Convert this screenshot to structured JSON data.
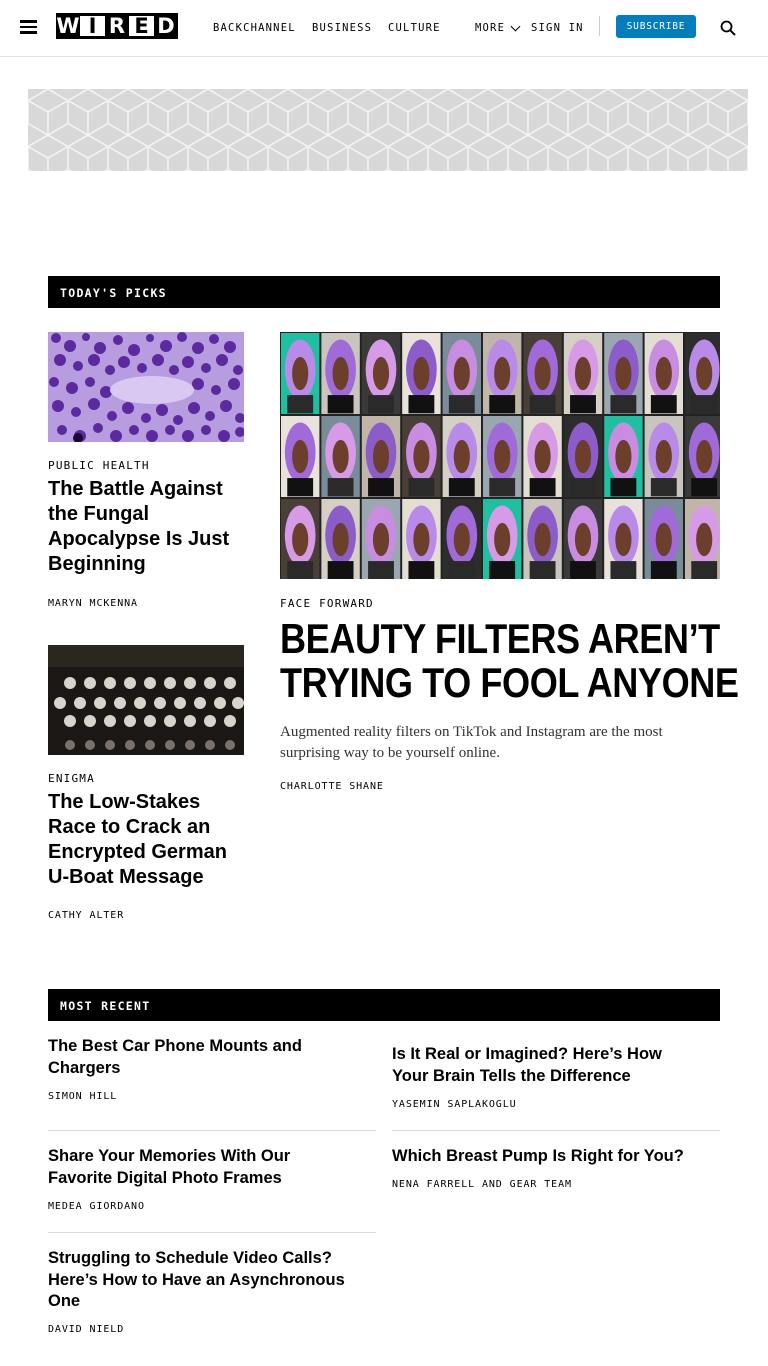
{
  "header": {
    "logo_letters": [
      "W",
      "I",
      "R",
      "E",
      "D"
    ],
    "nav_items": [
      "BACKCHANNEL",
      "BUSINESS",
      "CULTURE"
    ],
    "more_label": "MORE",
    "sign_in_label": "SIGN IN",
    "subscribe_label": "SUBSCRIBE",
    "subscribe_color": "#057dbc"
  },
  "todays_picks": {
    "title": "TODAY'S PICKS",
    "stories": [
      {
        "rubric": "PUBLIC HEALTH",
        "headline": "The Battle Against the Fungal Apocalypse Is Just Beginning",
        "byline": "MARYN MCKENNA",
        "image": "purple-cell-microscopy"
      },
      {
        "rubric": "ENIGMA",
        "headline": "The Low-Stakes Race to Crack an Encrypted German U-Boat Message",
        "byline": "CATHY ALTER",
        "image": "enigma-machine-keyboard"
      }
    ],
    "feature": {
      "rubric": "FACE FORWARD",
      "headline_line1": "BEAUTY FILTERS AREN’T",
      "headline_line2": "TRYING TO FOOL ANYONE",
      "dek": "Augmented reality filters on TikTok and Instagram are the most surprising way to be yourself online.",
      "byline": "CHARLOTTE SHANE",
      "image": "grid-of-filtered-selfies"
    }
  },
  "most_recent": {
    "title": "MOST RECENT",
    "left": [
      {
        "headline": "The Best Car Phone Mounts and Chargers",
        "byline": "SIMON HILL"
      },
      {
        "headline": "Share Your Memories With Our Favorite Digital Photo Frames",
        "byline": "MEDEA GIORDANO"
      },
      {
        "headline": "Struggling to Schedule Video Calls? Here’s How to Have an Asynchronous One",
        "byline": "DAVID NIELD"
      }
    ],
    "right": [
      {
        "headline": "Is It Real or Imagined? Here’s How Your Brain Tells the Difference",
        "byline": "YASEMIN SAPLAKOGLU"
      },
      {
        "headline": "Which Breast Pump Is Right for You?",
        "byline": "NENA FARRELL AND GEAR TEAM"
      }
    ]
  }
}
